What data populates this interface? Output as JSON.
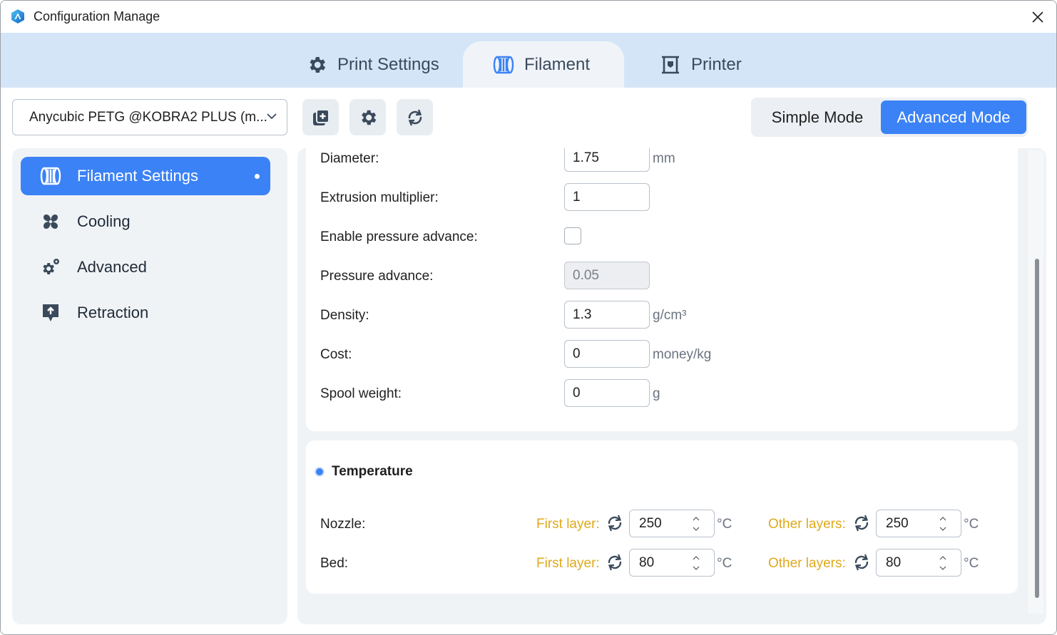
{
  "window": {
    "title": "Configuration Manage"
  },
  "tabs": [
    {
      "label": "Print Settings",
      "icon": "gear-icon"
    },
    {
      "label": "Filament",
      "icon": "filament-spool-icon",
      "active": true
    },
    {
      "label": "Printer",
      "icon": "printer-icon"
    }
  ],
  "toolbar": {
    "preset": "Anycubic PETG @KOBRA2 PLUS (m...",
    "simple_mode": "Simple Mode",
    "advanced_mode": "Advanced Mode",
    "active_mode": "Advanced Mode"
  },
  "sidebar": {
    "items": [
      {
        "label": "Filament Settings",
        "icon": "filament-spool-icon",
        "active": true,
        "modified": true
      },
      {
        "label": "Cooling",
        "icon": "fan-icon"
      },
      {
        "label": "Advanced",
        "icon": "advanced-gears-icon"
      },
      {
        "label": "Retraction",
        "icon": "retraction-icon"
      }
    ]
  },
  "filament": {
    "diameter": {
      "label": "Diameter:",
      "value": "1.75",
      "unit": "mm"
    },
    "extrusion_multiplier": {
      "label": "Extrusion multiplier:",
      "value": "1"
    },
    "pressure_advance_enable": {
      "label": "Enable pressure advance:",
      "checked": false
    },
    "pressure_advance": {
      "label": "Pressure advance:",
      "value": "0.05",
      "disabled": true
    },
    "density": {
      "label": "Density:",
      "value": "1.3",
      "unit": "g/cm³"
    },
    "cost": {
      "label": "Cost:",
      "value": "0",
      "unit": "money/kg"
    },
    "spool_weight": {
      "label": "Spool weight:",
      "value": "0",
      "unit": "g"
    }
  },
  "temperature": {
    "title": "Temperature",
    "first_layer_label": "First layer:",
    "other_layers_label": "Other layers:",
    "unit": "°C",
    "nozzle": {
      "label": "Nozzle:",
      "first_layer": "250",
      "other_layers": "250"
    },
    "bed": {
      "label": "Bed:",
      "first_layer": "80",
      "other_layers": "80"
    }
  },
  "colors": {
    "accent": "#3b82f6",
    "layer_label": "#e0a91c",
    "tab_bg": "#d5e5f8"
  }
}
